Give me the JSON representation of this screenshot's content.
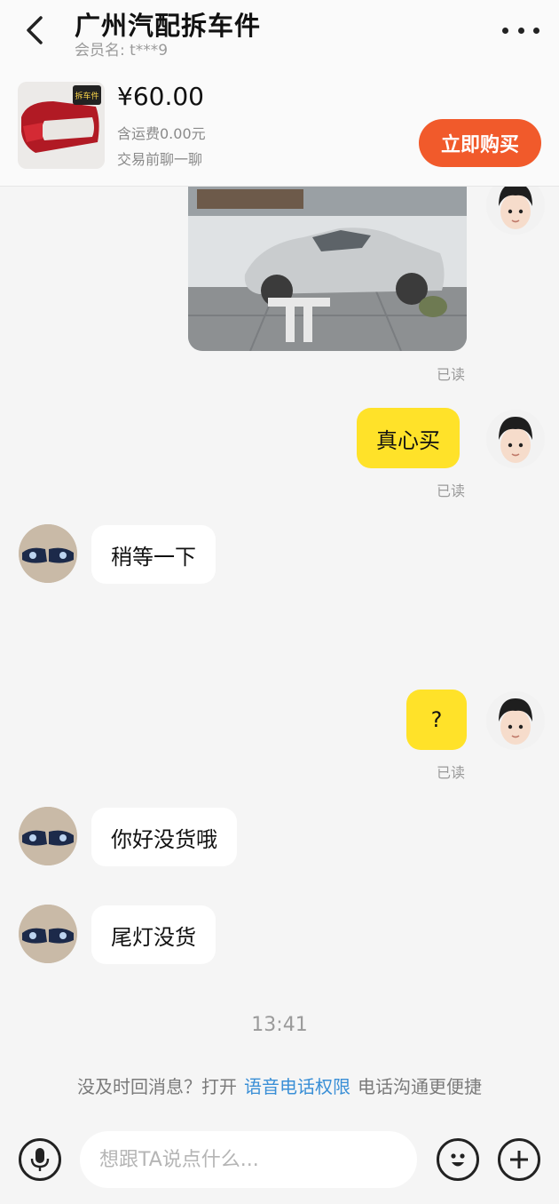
{
  "header": {
    "title": "广州汽配拆车件",
    "member_label": "会员名: t***9"
  },
  "product": {
    "price": "¥60.00",
    "shipping": "含运费0.00元",
    "chat_hint": "交易前聊一聊",
    "buy_label": "立即购买",
    "thumb_badge": "拆车件"
  },
  "messages": [
    {
      "side": "right",
      "type": "image",
      "status": "已读"
    },
    {
      "side": "right",
      "type": "text",
      "text": "真心买",
      "status": "已读"
    },
    {
      "side": "left",
      "type": "text",
      "text": "稍等一下"
    },
    {
      "side": "right",
      "type": "text",
      "text": "?",
      "status": "已读"
    },
    {
      "side": "left",
      "type": "text",
      "text": "你好没货哦"
    },
    {
      "side": "left",
      "type": "text",
      "text": "尾灯没货"
    }
  ],
  "time_separator": "13:41",
  "notice": {
    "before": "没及时回消息？打开",
    "link": "语音电话权限",
    "after": "电话沟通更便捷"
  },
  "input": {
    "placeholder": "想跟TA说点什么..."
  },
  "icons": {
    "back": "chevron-left-icon",
    "more": "more-dots-icon",
    "voice": "microphone-icon",
    "emoji": "smiley-icon",
    "add": "plus-icon"
  },
  "colors": {
    "accent_button": "#f15a2b",
    "my_bubble": "#ffe229",
    "their_bubble": "#ffffff",
    "link": "#3a8fd6"
  }
}
